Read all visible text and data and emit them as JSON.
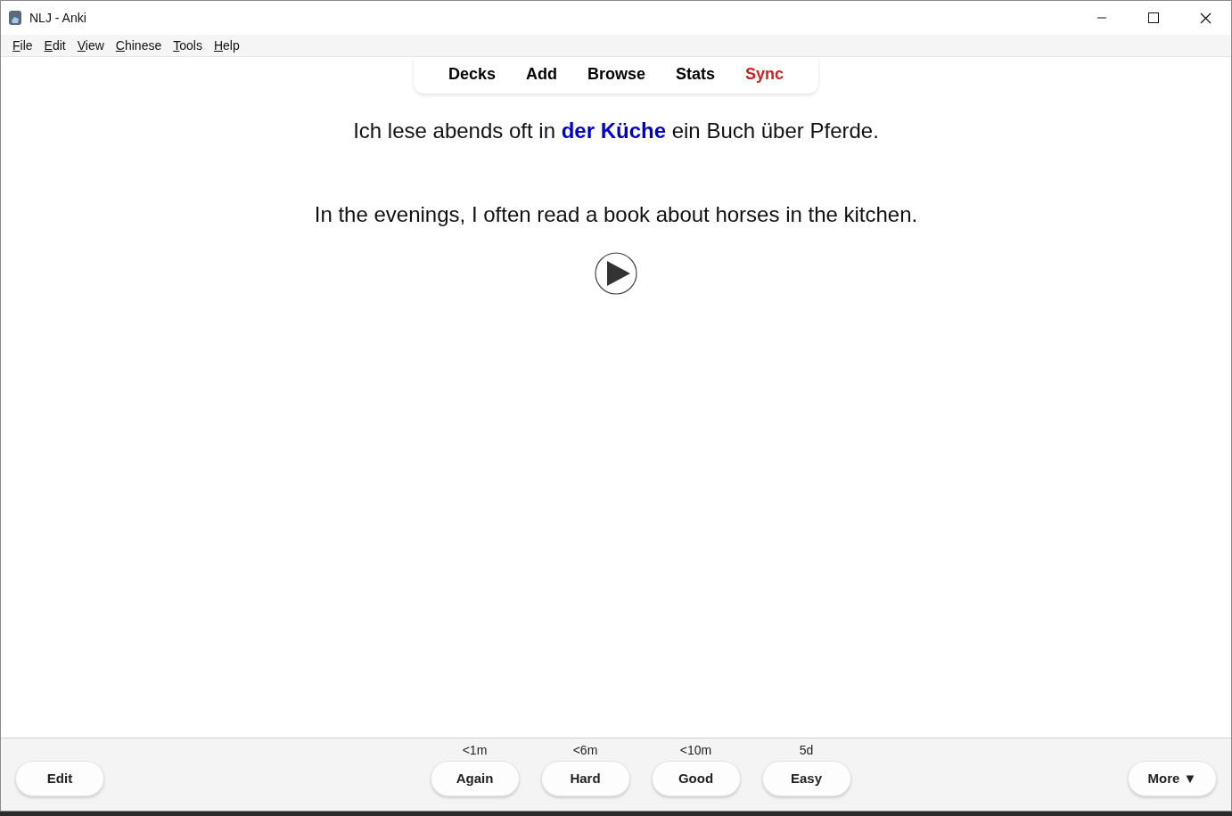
{
  "window": {
    "title": "NLJ - Anki"
  },
  "menu": [
    "File",
    "Edit",
    "View",
    "Chinese",
    "Tools",
    "Help"
  ],
  "toolbar": [
    {
      "label": "Decks",
      "color": "#000000"
    },
    {
      "label": "Add",
      "color": "#000000"
    },
    {
      "label": "Browse",
      "color": "#000000"
    },
    {
      "label": "Stats",
      "color": "#000000"
    },
    {
      "label": "Sync",
      "color": "#cc2222"
    }
  ],
  "card": {
    "front": "Ich lese abends oft in **der Küche** ein Buch über Pferde.",
    "back": "In the evenings, I often read a book about horses in the kitchen."
  },
  "bottom_bar": {
    "edit_button": "Edit",
    "answers": [
      {
        "interval": "<1m",
        "label": "Again"
      },
      {
        "interval": "<6m",
        "label": "Hard"
      },
      {
        "interval": "<10m",
        "label": "Good"
      },
      {
        "interval": "5d",
        "label": "Easy"
      }
    ],
    "more_button": "More ▼"
  }
}
